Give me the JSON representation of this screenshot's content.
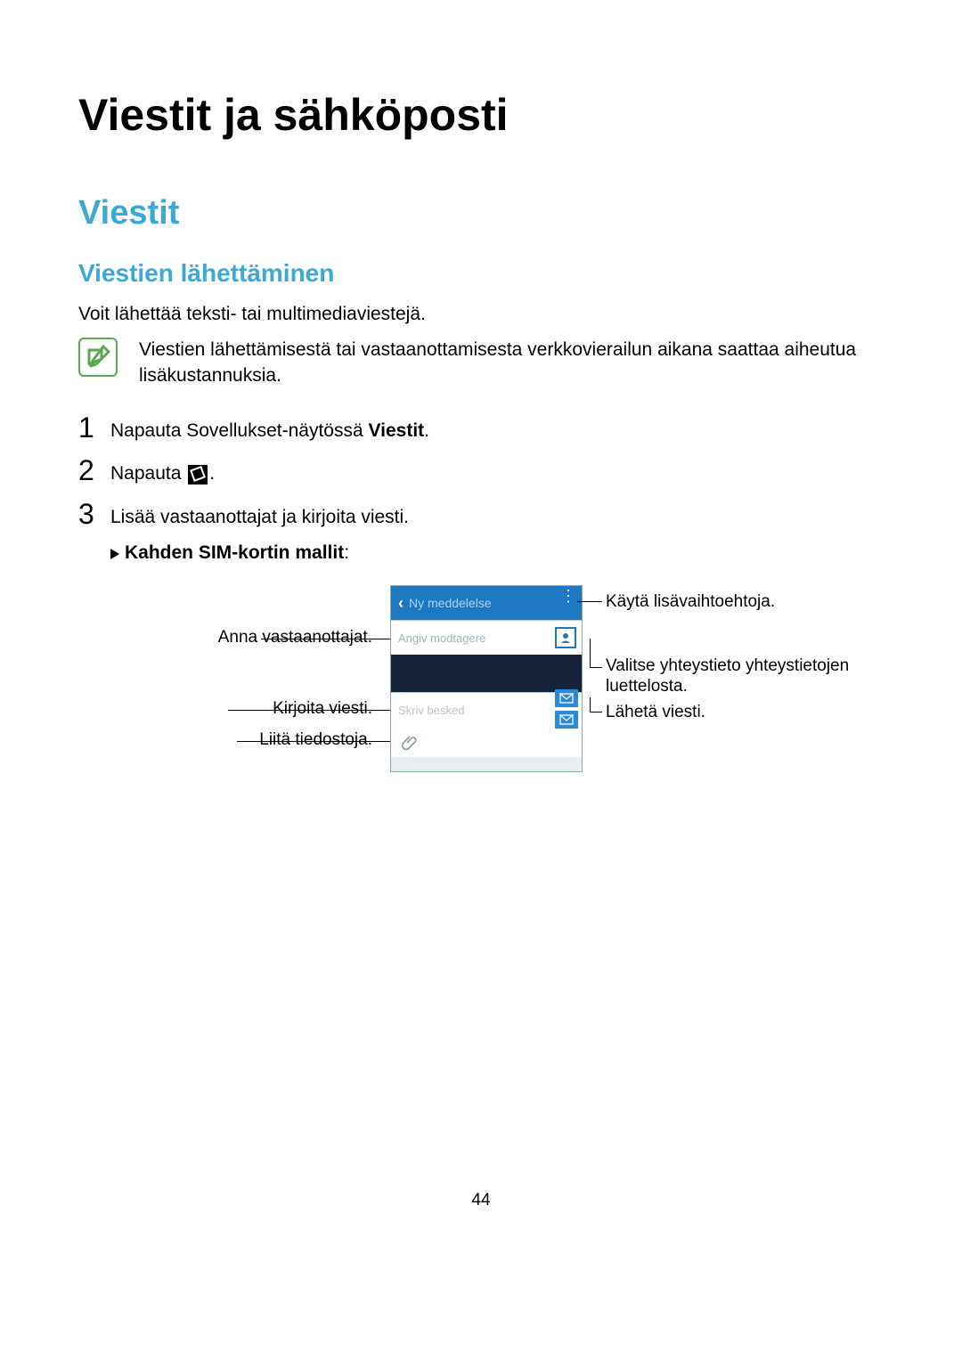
{
  "title": "Viestit ja sähköposti",
  "section": "Viestit",
  "subsection": "Viestien lähettäminen",
  "intro": "Voit lähettää teksti- tai multimediaviestejä.",
  "note": "Viestien lähettämisestä tai vastaanottamisesta verkkovierailun aikana saattaa aiheutua lisäkustannuksia.",
  "steps": {
    "s1_pre": "Napauta Sovellukset-näytössä ",
    "s1_bold": "Viestit",
    "s1_post": ".",
    "s2": "Napauta ",
    "s2_post": ".",
    "s3": "Lisää vastaanottajat ja kirjoita viesti.",
    "s3_sub_bold": "Kahden SIM-kortin mallit",
    "s3_sub_post": ":"
  },
  "phone": {
    "header": "Ny meddelelse",
    "recipients_placeholder": "Angiv modtagere",
    "message_placeholder": "Skriv besked"
  },
  "callouts": {
    "left_recipients": "Anna vastaanottajat.",
    "left_message": "Kirjoita viesti.",
    "left_attach": "Liitä tiedostoja.",
    "right_menu": "Käytä lisävaihtoehtoja.",
    "right_contacts": "Valitse yhteystieto yhteystietojen luettelosta.",
    "right_send": "Lähetä viesti."
  },
  "page_number": "44"
}
